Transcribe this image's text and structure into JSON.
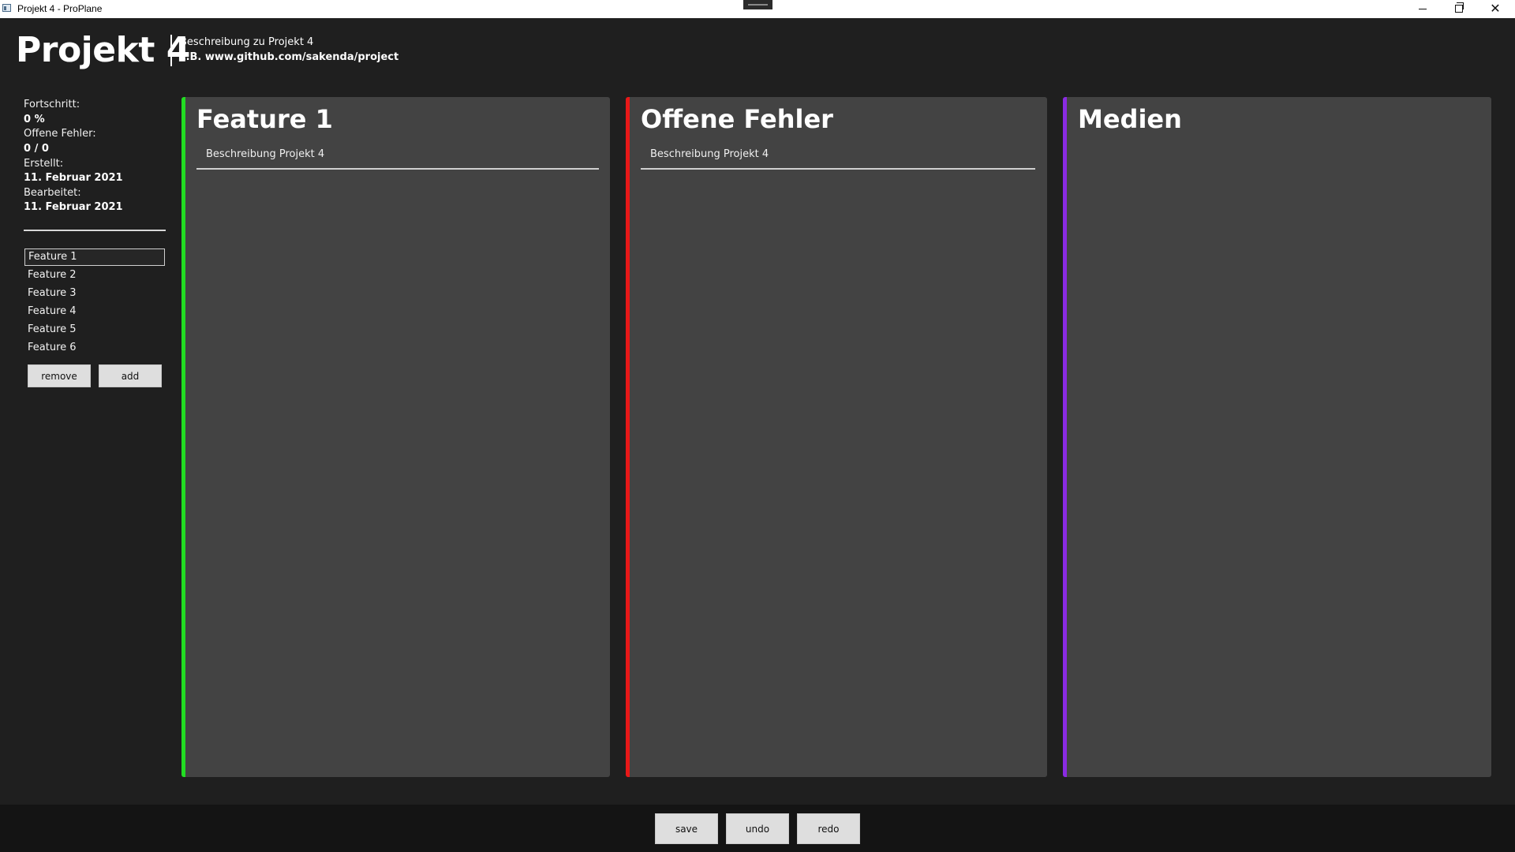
{
  "window": {
    "title": "Projekt 4 - ProPlane",
    "controls": {
      "minimize": "minimize-icon",
      "maximize": "restore-icon",
      "close": "close-icon"
    }
  },
  "header": {
    "project_name": "Projekt 4",
    "description": "Beschreibung zu Projekt 4",
    "link": "z.B. www.github.com/sakenda/project"
  },
  "sidebar": {
    "stats": {
      "progress_label": "Fortschritt:",
      "progress_value": "0 %",
      "errors_label": "Offene Fehler:",
      "errors_value": "0 / 0",
      "created_label": "Erstellt:",
      "created_value": "11. Februar 2021",
      "edited_label": "Bearbeitet:",
      "edited_value": "11. Februar 2021"
    },
    "features": [
      {
        "label": "Feature 1",
        "selected": true
      },
      {
        "label": "Feature 2",
        "selected": false
      },
      {
        "label": "Feature 3",
        "selected": false
      },
      {
        "label": "Feature 4",
        "selected": false
      },
      {
        "label": "Feature 5",
        "selected": false
      },
      {
        "label": "Feature 6",
        "selected": false
      }
    ],
    "remove_label": "remove",
    "add_label": "add"
  },
  "panels": {
    "feature": {
      "title": "Feature 1",
      "field_value": "Beschreibung Projekt 4",
      "accent": "#22dd22"
    },
    "errors": {
      "title": "Offene Fehler",
      "field_value": "Beschreibung Projekt 4",
      "accent": "#e81818"
    },
    "media": {
      "title": "Medien",
      "accent": "#8a2be2"
    }
  },
  "footer": {
    "save_label": "save",
    "undo_label": "undo",
    "redo_label": "redo"
  }
}
